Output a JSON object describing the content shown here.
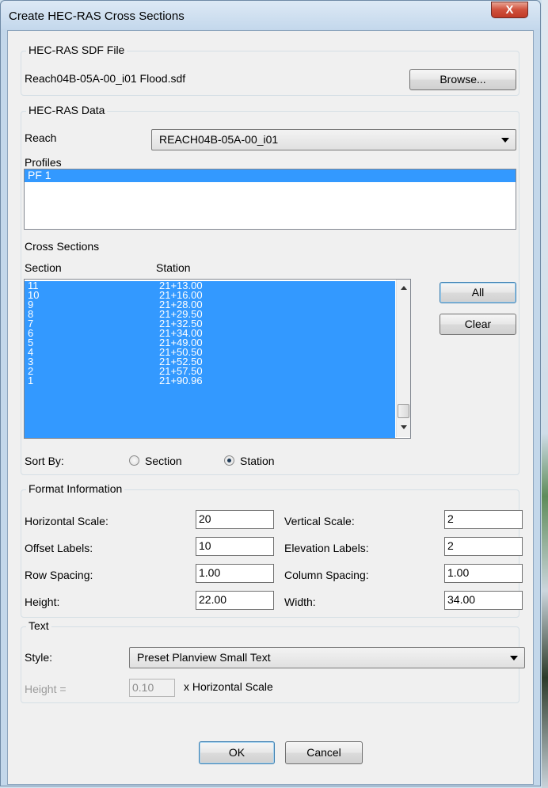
{
  "window": {
    "title": "Create HEC-RAS Cross Sections",
    "close_glyph": "X"
  },
  "sdf": {
    "legend": "HEC-RAS SDF File",
    "filename": "Reach04B-05A-00_i01 Flood.sdf",
    "browse_label": "Browse..."
  },
  "hecras": {
    "legend": "HEC-RAS Data",
    "reach_label": "Reach",
    "reach_value": "REACH04B-05A-00_i01",
    "profiles_label": "Profiles",
    "profiles": [
      "PF 1"
    ],
    "cross_sections_label": "Cross Sections",
    "col_section": "Section",
    "col_station": "Station",
    "rows": [
      {
        "section": "11",
        "station": "21+13.00"
      },
      {
        "section": "10",
        "station": "21+16.00"
      },
      {
        "section": "9",
        "station": "21+28.00"
      },
      {
        "section": "8",
        "station": "21+29.50"
      },
      {
        "section": "7",
        "station": "21+32.50"
      },
      {
        "section": "6",
        "station": "21+34.00"
      },
      {
        "section": "5",
        "station": "21+49.00"
      },
      {
        "section": "4",
        "station": "21+50.50"
      },
      {
        "section": "3",
        "station": "21+52.50"
      },
      {
        "section": "2",
        "station": "21+57.50"
      },
      {
        "section": "1",
        "station": "21+90.96"
      }
    ],
    "all_label": "All",
    "clear_label": "Clear",
    "sort_by_label": "Sort By:",
    "sort_section_label": "Section",
    "sort_station_label": "Station",
    "sort_selected": "Station"
  },
  "format": {
    "legend": "Format Information",
    "horizontal_scale_label": "Horizontal Scale:",
    "horizontal_scale": "20",
    "vertical_scale_label": "Vertical Scale:",
    "vertical_scale": "2",
    "offset_labels_label": "Offset Labels:",
    "offset_labels": "10",
    "elevation_labels_label": "Elevation Labels:",
    "elevation_labels": "2",
    "row_spacing_label": "Row Spacing:",
    "row_spacing": "1.00",
    "column_spacing_label": "Column Spacing:",
    "column_spacing": "1.00",
    "height_label": "Height:",
    "height": "22.00",
    "width_label": "Width:",
    "width": "34.00"
  },
  "text": {
    "legend": "Text",
    "style_label": "Style:",
    "style_value": "Preset Planview Small Text",
    "height_label": "Height =",
    "height_value": "0.10",
    "height_suffix": "x Horizontal Scale"
  },
  "buttons": {
    "ok_label": "OK",
    "cancel_label": "Cancel"
  },
  "colors": {
    "selection": "#3399ff",
    "close_button": "#c8452f",
    "dialog_bg": "#f0f0f0"
  }
}
